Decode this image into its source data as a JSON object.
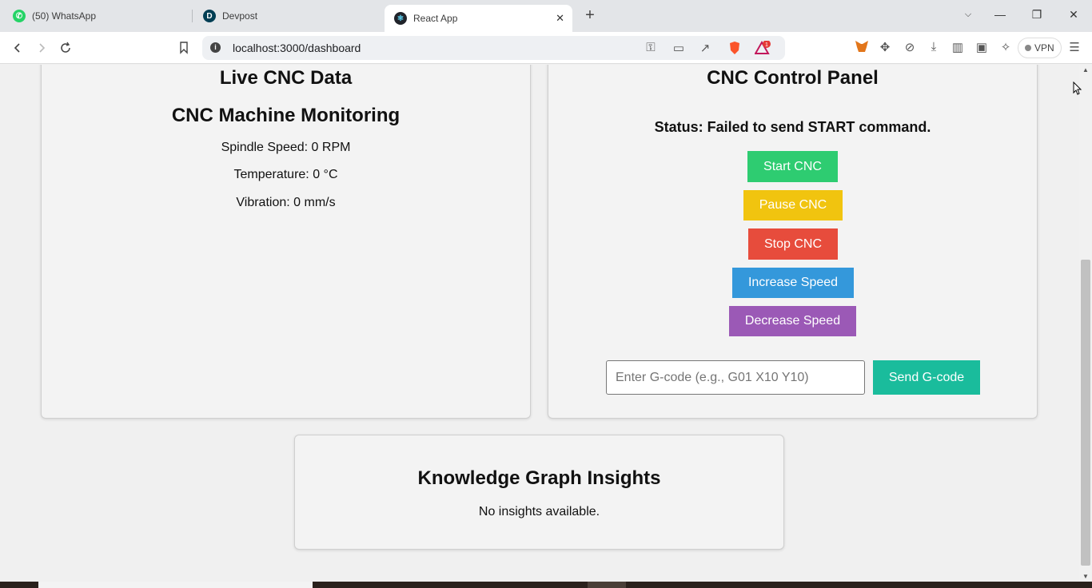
{
  "browser": {
    "tabs": [
      {
        "title": "(50) WhatsApp",
        "icon": "whatsapp-icon"
      },
      {
        "title": "Devpost",
        "icon": "devpost-icon"
      },
      {
        "title": "React App",
        "icon": "react-icon",
        "active": true
      }
    ],
    "new_tab_symbol": "+",
    "url": "localhost:3000/dashboard",
    "vpn_label": "VPN",
    "notification_count": "1"
  },
  "live_data": {
    "heading": "Live CNC Data",
    "subheading": "CNC Machine Monitoring",
    "spindle_speed": "Spindle Speed: 0 RPM",
    "temperature": "Temperature: 0 °C",
    "vibration": "Vibration: 0 mm/s"
  },
  "control_panel": {
    "heading": "CNC Control Panel",
    "status": "Status: Failed to send START command.",
    "buttons": {
      "start": "Start CNC",
      "pause": "Pause CNC",
      "stop": "Stop CNC",
      "increase": "Increase Speed",
      "decrease": "Decrease Speed"
    },
    "gcode_placeholder": "Enter G-code (e.g., G01 X10 Y10)",
    "gcode_value": "",
    "send_label": "Send G-code"
  },
  "insights": {
    "heading": "Knowledge Graph Insights",
    "message": "No insights available."
  },
  "colors": {
    "start": "#2ecc71",
    "pause": "#f1c40f",
    "stop": "#e74c3c",
    "increase": "#3498db",
    "decrease": "#9b59b6",
    "send": "#1abc9c"
  }
}
